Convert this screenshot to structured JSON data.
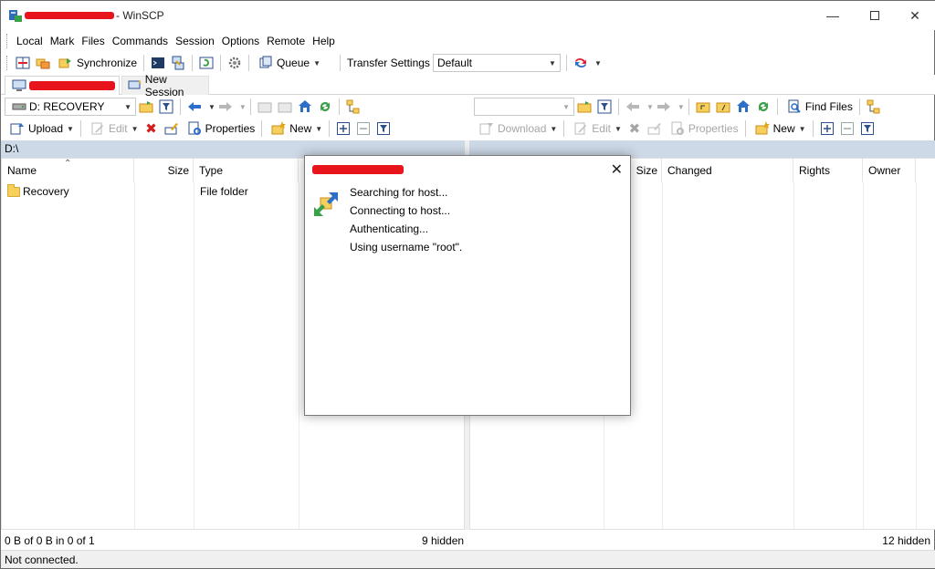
{
  "window": {
    "title": "- WinSCP"
  },
  "menu": [
    "Local",
    "Mark",
    "Files",
    "Commands",
    "Session",
    "Options",
    "Remote",
    "Help"
  ],
  "toolbar": {
    "synchronize": "Synchronize",
    "queue": "Queue",
    "transfer_settings_label": "Transfer Settings",
    "transfer_settings_value": "Default"
  },
  "tabs": {
    "new_session": "New Session"
  },
  "left": {
    "drive": "D: RECOVERY",
    "upload": "Upload",
    "edit": "Edit",
    "properties": "Properties",
    "new": "New",
    "path": "D:\\",
    "columns": {
      "name": "Name",
      "size": "Size",
      "type": "Type"
    },
    "rows": [
      {
        "name": "Recovery",
        "type": "File folder"
      }
    ],
    "status": "0 B of 0 B in 0 of 1",
    "hidden": "9 hidden"
  },
  "right": {
    "download": "Download",
    "edit": "Edit",
    "properties": "Properties",
    "new": "New",
    "find_files": "Find Files",
    "columns": {
      "size": "Size",
      "changed": "Changed",
      "rights": "Rights",
      "owner": "Owner"
    },
    "hidden": "12 hidden"
  },
  "status_bar": {
    "connection": "Not connected."
  },
  "dialog": {
    "lines": [
      "Searching for host...",
      "Connecting to host...",
      "Authenticating...",
      "Using username \"root\"."
    ]
  },
  "colors": {
    "path_bar": "#cdd9e7",
    "redaction": "#e8141b",
    "folder": "#f6cf5c"
  }
}
